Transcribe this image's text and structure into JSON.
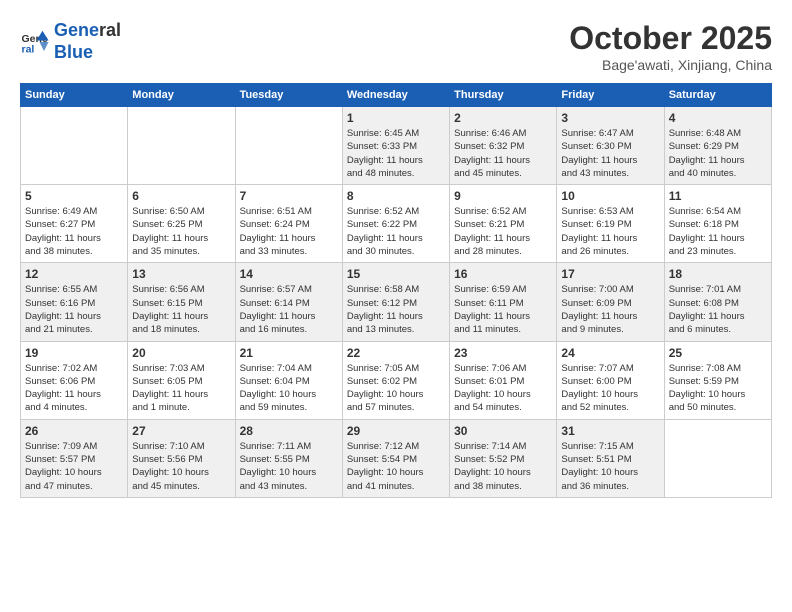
{
  "header": {
    "logo_line1": "General",
    "logo_line2": "Blue",
    "month_title": "October 2025",
    "subtitle": "Bage'awati, Xinjiang, China"
  },
  "weekdays": [
    "Sunday",
    "Monday",
    "Tuesday",
    "Wednesday",
    "Thursday",
    "Friday",
    "Saturday"
  ],
  "weeks": [
    [
      {
        "day": "",
        "info": ""
      },
      {
        "day": "",
        "info": ""
      },
      {
        "day": "",
        "info": ""
      },
      {
        "day": "1",
        "info": "Sunrise: 6:45 AM\nSunset: 6:33 PM\nDaylight: 11 hours\nand 48 minutes."
      },
      {
        "day": "2",
        "info": "Sunrise: 6:46 AM\nSunset: 6:32 PM\nDaylight: 11 hours\nand 45 minutes."
      },
      {
        "day": "3",
        "info": "Sunrise: 6:47 AM\nSunset: 6:30 PM\nDaylight: 11 hours\nand 43 minutes."
      },
      {
        "day": "4",
        "info": "Sunrise: 6:48 AM\nSunset: 6:29 PM\nDaylight: 11 hours\nand 40 minutes."
      }
    ],
    [
      {
        "day": "5",
        "info": "Sunrise: 6:49 AM\nSunset: 6:27 PM\nDaylight: 11 hours\nand 38 minutes."
      },
      {
        "day": "6",
        "info": "Sunrise: 6:50 AM\nSunset: 6:25 PM\nDaylight: 11 hours\nand 35 minutes."
      },
      {
        "day": "7",
        "info": "Sunrise: 6:51 AM\nSunset: 6:24 PM\nDaylight: 11 hours\nand 33 minutes."
      },
      {
        "day": "8",
        "info": "Sunrise: 6:52 AM\nSunset: 6:22 PM\nDaylight: 11 hours\nand 30 minutes."
      },
      {
        "day": "9",
        "info": "Sunrise: 6:52 AM\nSunset: 6:21 PM\nDaylight: 11 hours\nand 28 minutes."
      },
      {
        "day": "10",
        "info": "Sunrise: 6:53 AM\nSunset: 6:19 PM\nDaylight: 11 hours\nand 26 minutes."
      },
      {
        "day": "11",
        "info": "Sunrise: 6:54 AM\nSunset: 6:18 PM\nDaylight: 11 hours\nand 23 minutes."
      }
    ],
    [
      {
        "day": "12",
        "info": "Sunrise: 6:55 AM\nSunset: 6:16 PM\nDaylight: 11 hours\nand 21 minutes."
      },
      {
        "day": "13",
        "info": "Sunrise: 6:56 AM\nSunset: 6:15 PM\nDaylight: 11 hours\nand 18 minutes."
      },
      {
        "day": "14",
        "info": "Sunrise: 6:57 AM\nSunset: 6:14 PM\nDaylight: 11 hours\nand 16 minutes."
      },
      {
        "day": "15",
        "info": "Sunrise: 6:58 AM\nSunset: 6:12 PM\nDaylight: 11 hours\nand 13 minutes."
      },
      {
        "day": "16",
        "info": "Sunrise: 6:59 AM\nSunset: 6:11 PM\nDaylight: 11 hours\nand 11 minutes."
      },
      {
        "day": "17",
        "info": "Sunrise: 7:00 AM\nSunset: 6:09 PM\nDaylight: 11 hours\nand 9 minutes."
      },
      {
        "day": "18",
        "info": "Sunrise: 7:01 AM\nSunset: 6:08 PM\nDaylight: 11 hours\nand 6 minutes."
      }
    ],
    [
      {
        "day": "19",
        "info": "Sunrise: 7:02 AM\nSunset: 6:06 PM\nDaylight: 11 hours\nand 4 minutes."
      },
      {
        "day": "20",
        "info": "Sunrise: 7:03 AM\nSunset: 6:05 PM\nDaylight: 11 hours\nand 1 minute."
      },
      {
        "day": "21",
        "info": "Sunrise: 7:04 AM\nSunset: 6:04 PM\nDaylight: 10 hours\nand 59 minutes."
      },
      {
        "day": "22",
        "info": "Sunrise: 7:05 AM\nSunset: 6:02 PM\nDaylight: 10 hours\nand 57 minutes."
      },
      {
        "day": "23",
        "info": "Sunrise: 7:06 AM\nSunset: 6:01 PM\nDaylight: 10 hours\nand 54 minutes."
      },
      {
        "day": "24",
        "info": "Sunrise: 7:07 AM\nSunset: 6:00 PM\nDaylight: 10 hours\nand 52 minutes."
      },
      {
        "day": "25",
        "info": "Sunrise: 7:08 AM\nSunset: 5:59 PM\nDaylight: 10 hours\nand 50 minutes."
      }
    ],
    [
      {
        "day": "26",
        "info": "Sunrise: 7:09 AM\nSunset: 5:57 PM\nDaylight: 10 hours\nand 47 minutes."
      },
      {
        "day": "27",
        "info": "Sunrise: 7:10 AM\nSunset: 5:56 PM\nDaylight: 10 hours\nand 45 minutes."
      },
      {
        "day": "28",
        "info": "Sunrise: 7:11 AM\nSunset: 5:55 PM\nDaylight: 10 hours\nand 43 minutes."
      },
      {
        "day": "29",
        "info": "Sunrise: 7:12 AM\nSunset: 5:54 PM\nDaylight: 10 hours\nand 41 minutes."
      },
      {
        "day": "30",
        "info": "Sunrise: 7:14 AM\nSunset: 5:52 PM\nDaylight: 10 hours\nand 38 minutes."
      },
      {
        "day": "31",
        "info": "Sunrise: 7:15 AM\nSunset: 5:51 PM\nDaylight: 10 hours\nand 36 minutes."
      },
      {
        "day": "",
        "info": ""
      }
    ]
  ]
}
